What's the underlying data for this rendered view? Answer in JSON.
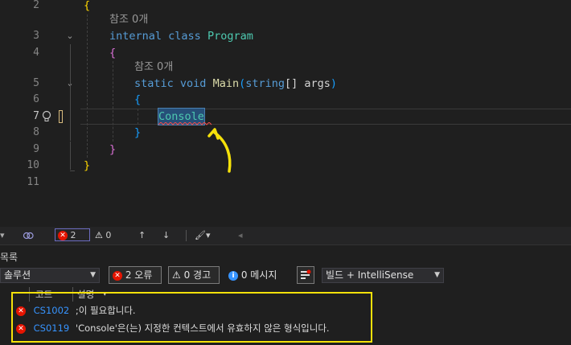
{
  "editor": {
    "line_numbers": [
      "2",
      "3",
      "4",
      "5",
      "6",
      "7",
      "8",
      "9",
      "10",
      "11"
    ],
    "active_line": "7",
    "references_label_1": "참조 0개",
    "references_label_2": "참조 0개",
    "class_line": {
      "kw1": "internal",
      "kw2": "class",
      "name": "Program"
    },
    "main_line": {
      "kw1": "static",
      "kw2": "void",
      "fn": "Main",
      "paren_open": "(",
      "type": "string",
      "brackets": "[]",
      "arg": " args",
      ")": ")"
    },
    "typed_token": "Console",
    "braces": {
      "open": "{",
      "close": "}"
    }
  },
  "statusbar": {
    "error_count": "2",
    "warning_count": "0"
  },
  "error_panel": {
    "title": "목록",
    "scope_select": "솔루션",
    "errors_button": "2 오류",
    "warnings_button": "0 경고",
    "messages_button": "0 메시지",
    "source_select": "빌드 + IntelliSense",
    "columns": {
      "code": "코드",
      "description": "설명"
    },
    "rows": [
      {
        "code": "CS1002",
        "description": ";이 필요합니다."
      },
      {
        "code": "CS0119",
        "description": "'Console'은(는) 지정한 컨텍스트에서 유효하지 않은 형식입니다."
      }
    ]
  },
  "colors": {
    "error": "#e51400",
    "annotation": "#f5e10a",
    "link": "#3794ff"
  }
}
